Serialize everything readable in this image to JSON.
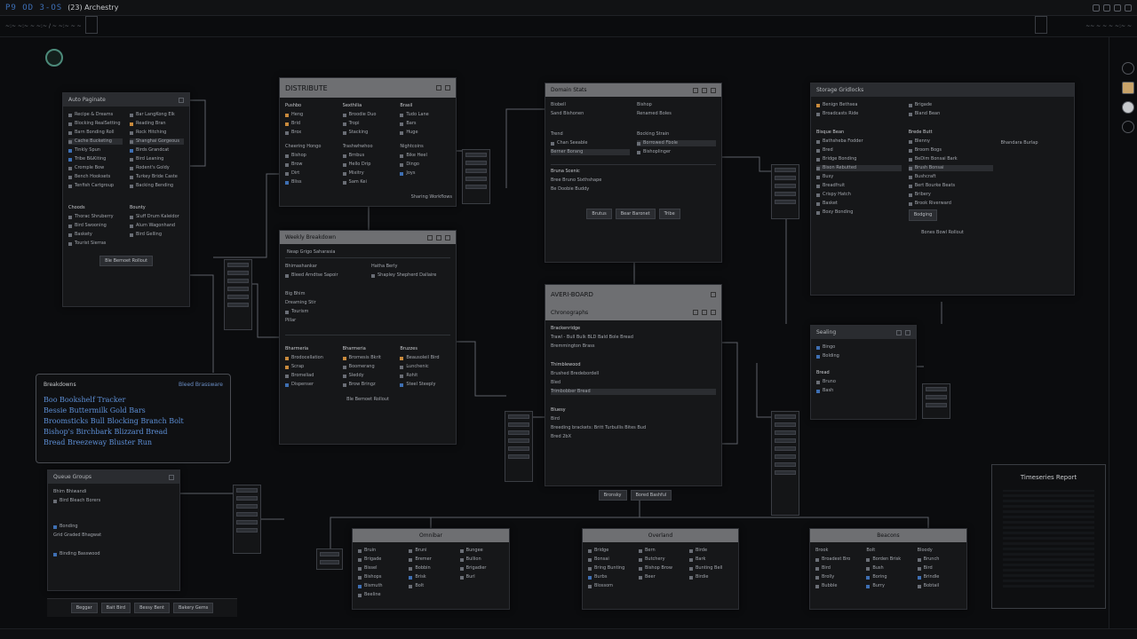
{
  "app": {
    "logo": "P9 OD 3-OS",
    "title": "(23) Archestry"
  },
  "subbar": {
    "crumb": "~:~ ~:~ ~ ~:~  /  ~ ~:~ ~ ~",
    "right": "~~ ~ ~ ~ ~:~ ~"
  },
  "windows": {
    "w1": {
      "title": "Auto Paginate",
      "col1": [
        "Recipe & Dreams",
        "Blocking RealSetting",
        "Barn Bonding Roll",
        "Cache Bucketing",
        "Tinkly Spun",
        "Tribe B&Kiting",
        "Cromple Bow",
        "Bench Hooksets",
        "Tenfish Cartgroup"
      ],
      "col2": [
        "Bar LangKong Elk",
        "Reading Bran",
        "Rock Hitching",
        "Shanghai Gorgeous",
        "Birds Grandcat",
        "Bird Leaning",
        "Rodent's Goldy",
        "Turkey Bride Caste",
        "Backing Bending"
      ],
      "col3": [
        "Choods",
        "Thorac Shruberry",
        "Bird Swooning",
        "Baskety",
        "Tourist Sierras"
      ],
      "col4": [
        "Bounty",
        "Sluff Drum Kaleidor",
        "Alum Wagonhand",
        "Bird Gelling"
      ],
      "footer": "Ble Bemoet Rollout"
    },
    "w2": {
      "title": "DISTRIBUTE",
      "col1": [
        "Pushbo",
        "Heng",
        "Brid",
        "Brox",
        "Cheering Hongo",
        "Bishop",
        "Brow",
        "Dirt",
        "Bliss"
      ],
      "col2": [
        "Sexthilia",
        "Broodie Duo",
        "Tropi",
        "Stacking",
        "Trashwhwhoo",
        "Brnbus",
        "Hello Drip",
        "Mixitry",
        "Sam Kei"
      ],
      "col3": [
        "Brasil",
        "Tudo Lane",
        "Bars",
        "Huge",
        "Nightcoins",
        "Bike Heel",
        "Dingo",
        "Joys"
      ],
      "footer": "Sharing Workflows"
    },
    "w3": {
      "title": "Weekly Breakdown",
      "banner": "Neap Grigo Saharasia",
      "col1": [
        "Bhimashankar",
        "Bleed Arndtse Sapoir",
        "Big Bhim",
        "Dreaming Stir",
        "Tourism",
        "Pillar"
      ],
      "col2": [
        "Hatha Berly",
        "Shapley Shepherd Dallaire"
      ],
      "col3": [
        "Bharmeria",
        "Brodocellation",
        "Scrap",
        "Bromeliad",
        "Dispenser"
      ],
      "col4": [
        "Bharmeria",
        "Bromesis Bkrit",
        "Boomerang",
        "Sleddy",
        "Brow Bringz"
      ],
      "col5": [
        "Bruzzes",
        "Beausoleil Bird",
        "Lunchenic",
        "Rohit",
        "Steel Steeply"
      ],
      "footer": "Ble Bemoet Rollout"
    },
    "w4": {
      "title": "Domain Stats",
      "col1": [
        "Biobell",
        "Sand Bishonen",
        "Trend",
        "Chan Seeable",
        "Berner Borang"
      ],
      "col2": [
        "Bishop",
        "Renamed Boles",
        "Bocking Strain",
        "Borrowed Fbole",
        "Bishoplinger"
      ],
      "mid1": [
        "Bruna Scenic",
        "Bree Bruno Sixthshape",
        "Be Doobie Buddy"
      ],
      "buttons": [
        "Brutus",
        "Bear Baronet",
        "Tribe"
      ]
    },
    "w5": {
      "title": "AVERI-BOARD",
      "sub": "Chronographs",
      "sec1": [
        "Brackenridge",
        "Trawl - Bull Bulk BLD Bald Bole Bread",
        "Bremmington Brass"
      ],
      "sec2": [
        "Thimblewood",
        "Brushed Bredebordell",
        "Bled",
        "Trimbobber Bread"
      ],
      "sec3": [
        "Bluesy",
        "Bird",
        "Breeding brackets: Britt Turbullis Bites Bud"
      ],
      "footer": "Bred 2bX",
      "buttons": [
        "Bronsky",
        "Bored Bashful"
      ]
    },
    "w6": {
      "title": "Storage Gridlocks",
      "col1": [
        "Benign Bethsea",
        "Broadcasts Ride",
        "Bisque Bean",
        "Bathsheba Fodder",
        "Bred",
        "Bridge Bonding",
        "Bison Rebutted",
        "Busy",
        "Breadfruit",
        "Crispy Hatch",
        "Basket",
        "Boxy Bonding"
      ],
      "col2": [
        "Brigade",
        "Bland Bean",
        "Brede Butt",
        "Blenny",
        "Broom Bogs",
        "BeDim Bonsai Bark",
        "Brush Bonsai",
        "Bushcraft",
        "Bert Bourke Beats",
        "Bribery",
        "Brook Riverward",
        "Bodging"
      ],
      "col3": [
        "Bhandara Burlap"
      ],
      "footer": "Bones Bowl Rollout"
    },
    "w7": {
      "title": "Sealing",
      "items": [
        "Bingo",
        "Bolding",
        "Bread",
        "Bruno",
        "Bash"
      ]
    },
    "w8": {
      "title": "Queue Groups",
      "lines": [
        "Bhim Bhiwandi",
        "Bird Bleach Borers",
        "Bonding",
        "Grid Graded Bhagwat",
        "Binding Basswood"
      ],
      "buttons": [
        "Beggar",
        "Bait Bird",
        "Bessy Bent",
        "Bakery Gems"
      ]
    },
    "w9": {
      "title": "Omnibar",
      "col1": [
        "Bruin",
        "Brigade",
        "Bissel",
        "Bishops",
        "Bismuth",
        "Beeline"
      ],
      "col2": [
        "Bruni",
        "Bremer",
        "Bobbin",
        "Brisk",
        "Bolt"
      ],
      "col3": [
        "Bungee",
        "Bullion",
        "Brigadier",
        "Burl"
      ]
    },
    "w10": {
      "title": "Overland",
      "col1": [
        "Bridge",
        "Bonsai",
        "Bring Bunting",
        "Burbs",
        "Blossom"
      ],
      "col2": [
        "Bern",
        "Butchery",
        "Bishop Brow",
        "Beer"
      ],
      "col3": [
        "Birde",
        "Bark",
        "Bunting Bell",
        "Birdie"
      ]
    },
    "w11": {
      "title": "Beacons",
      "col1": [
        "Brook",
        "Broadest Bro",
        "Bird",
        "Brolly",
        "Bubble"
      ],
      "col2": [
        "Bolt",
        "Borden Brisk",
        "Bush",
        "Boring",
        "Burry"
      ],
      "col3": [
        "Bloody",
        "Brunch",
        "Bird",
        "Brindle",
        "Bobtail"
      ]
    }
  },
  "panel": {
    "title": "Breakdowns",
    "right": "Bleed Brassware",
    "lines": [
      "Boo Bookshelf Tracker",
      "Bessie Buttermilk Gold Bars",
      "Broomsticks Bull Blocking Branch Bolt",
      "Bishop's Birchbark Blizzard Bread",
      "Bread Breezeway Bluster Run"
    ]
  },
  "thumb": {
    "title": "Timeseries Report"
  }
}
